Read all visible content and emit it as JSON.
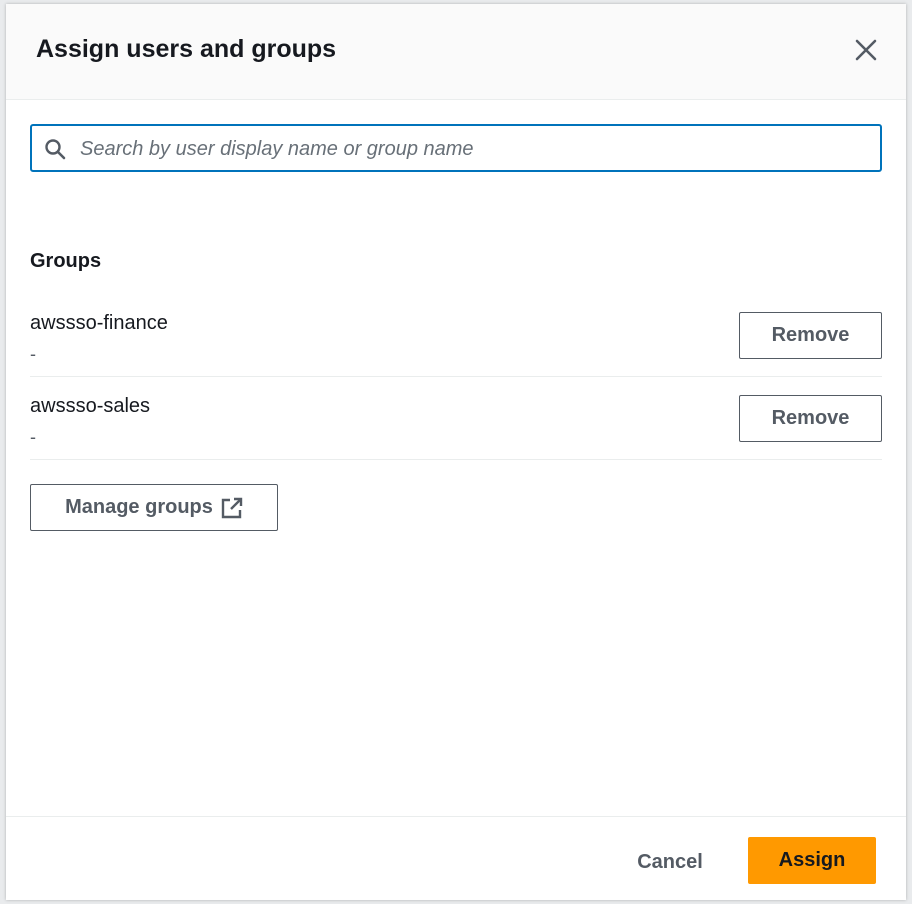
{
  "modal": {
    "title": "Assign users and groups"
  },
  "search": {
    "placeholder": "Search by user display name or group name",
    "value": ""
  },
  "groups_section": {
    "heading": "Groups",
    "items": [
      {
        "name": "awssso-finance",
        "description": "-",
        "action_label": "Remove"
      },
      {
        "name": "awssso-sales",
        "description": "-",
        "action_label": "Remove"
      }
    ],
    "manage_label": "Manage groups"
  },
  "footer": {
    "cancel_label": "Cancel",
    "assign_label": "Assign"
  },
  "colors": {
    "primary_button": "#ff9900",
    "search_focus_border": "#0073bb",
    "text_primary": "#16191f",
    "text_secondary": "#545b64"
  },
  "icons": {
    "close": "close-icon",
    "search": "search-icon",
    "external_link": "external-link-icon"
  }
}
